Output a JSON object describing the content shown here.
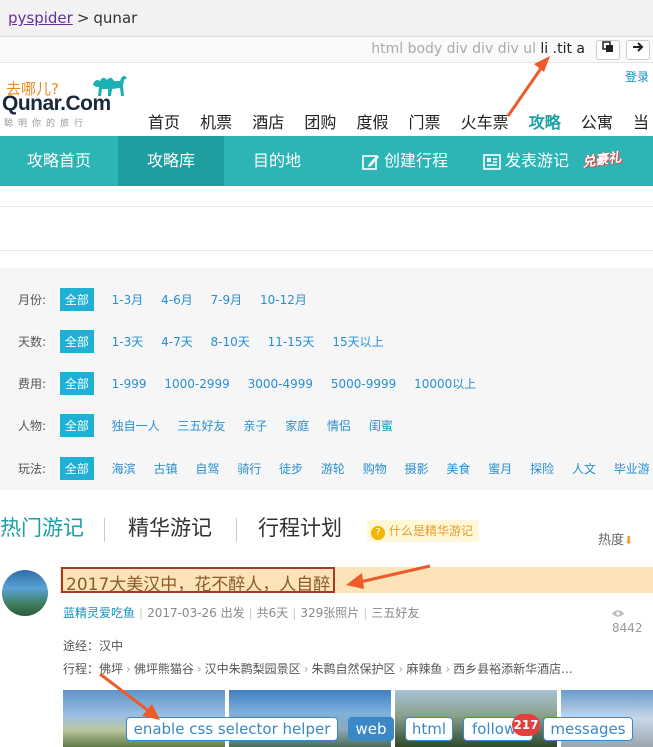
{
  "topbar": {
    "link": "pyspider",
    "sep": ">",
    "title": "qunar"
  },
  "pathbar": {
    "parts": [
      "html",
      "body",
      "div",
      "div",
      "div",
      "ul"
    ],
    "highlight": "li .tit a",
    "copy_icon": "copy-icon",
    "go_icon": "arrow-right-icon"
  },
  "header": {
    "logo_top": "去哪儿?",
    "logo_brand": "Qunar.Com",
    "logo_slogan": "聪明你的旅行",
    "login": "登录",
    "nav": [
      "首页",
      "机票",
      "酒店",
      "团购",
      "度假",
      "门票",
      "火车票",
      "攻略",
      "公寓",
      "当"
    ],
    "active_nav": "攻略"
  },
  "strip": {
    "items": [
      "攻略首页",
      "攻略库",
      "目的地",
      "创建行程",
      "发表游记"
    ],
    "active": "攻略库",
    "badge": "兑豪礼"
  },
  "filters": [
    {
      "label": "月份:",
      "options": [
        "全部",
        "1-3月",
        "4-6月",
        "7-9月",
        "10-12月"
      ]
    },
    {
      "label": "天数:",
      "options": [
        "全部",
        "1-3天",
        "4-7天",
        "8-10天",
        "11-15天",
        "15天以上"
      ]
    },
    {
      "label": "费用:",
      "options": [
        "全部",
        "1-999",
        "1000-2999",
        "3000-4999",
        "5000-9999",
        "10000以上"
      ]
    },
    {
      "label": "人物:",
      "options": [
        "全部",
        "独自一人",
        "三五好友",
        "亲子",
        "家庭",
        "情侣",
        "闺蜜"
      ]
    },
    {
      "label": "玩法:",
      "options": [
        "全部",
        "海滨",
        "古镇",
        "自驾",
        "骑行",
        "徒步",
        "游轮",
        "购物",
        "摄影",
        "美食",
        "蜜月",
        "探险",
        "人文",
        "毕业游"
      ]
    }
  ],
  "tabs": {
    "items": [
      "热门游记",
      "精华游记",
      "行程计划"
    ],
    "tip": "什么是精华游记",
    "sort": "热度"
  },
  "article": {
    "title": "2017大美汉中，花不醉人，人自醉",
    "author": "蓝精灵爱吃鱼",
    "date": "2017-03-26 出发",
    "days": "共6天",
    "photos": "329张照片",
    "people": "三五好友",
    "views": "8442",
    "route": "途经：汉中",
    "itin_label": "行程：",
    "itinerary": [
      "佛坪",
      "佛坪熊猫谷",
      "汉中朱鹮梨园景区",
      "朱鹮自然保护区",
      "麻辣鱼",
      "西乡县裕添新华酒店..."
    ]
  },
  "helper": {
    "enable": "enable css selector helper",
    "web": "web",
    "html": "html",
    "follows": "follows",
    "count": "217",
    "messages": "messages"
  },
  "colors": {
    "teal": "#2db5b6",
    "accent": "#1aa0a6",
    "annotation": "#ee5a2a",
    "link_blue": "#2a8fd0"
  }
}
